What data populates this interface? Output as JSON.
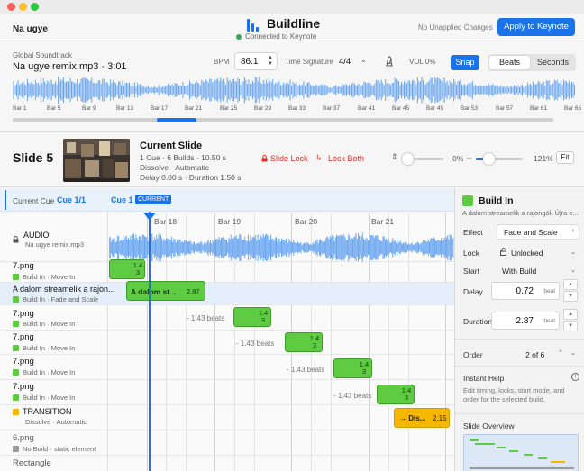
{
  "window": {
    "traffic": {
      "close": "#ff5f57",
      "minimize": "#febc2e",
      "zoom": "#28c840"
    }
  },
  "header": {
    "doc_title": "Na ugye",
    "app_name": "Buildline",
    "connection": "Connected to Keynote",
    "unapplied": "No Unapplied Changes",
    "apply_button": "Apply to Keynote"
  },
  "soundtrack": {
    "section_label": "Global Soundtrack",
    "track": "Na ugye remix.mp3 · 3:01",
    "bpm_label": "BPM",
    "bpm_value": "86.1",
    "ts_label": "Time Signature",
    "ts_value": "4/4",
    "volume": "VOL 0%",
    "snap": "Snap",
    "units": {
      "beats": "Beats",
      "seconds": "Seconds",
      "selected": "Beats"
    },
    "overview_bars": [
      "Bar 1",
      "Bar 5",
      "Bar 9",
      "Bar 13",
      "Bar 17",
      "Bar 21",
      "Bar 25",
      "Bar 29",
      "Bar 33",
      "Bar 37",
      "Bar 41",
      "Bar 45",
      "Bar 49",
      "Bar 53",
      "Bar 57",
      "Bar 61",
      "Bar 65"
    ]
  },
  "slide": {
    "number": "Slide 5",
    "title": "Current Slide",
    "summary": "1 Cue · 6 Builds · 10.50 s",
    "transition": "Dissolve · Automatic",
    "timing": "Delay 0.00 s · Duration 1.50 s",
    "slide_lock": "Slide Lock",
    "lock_both": "Lock Both",
    "zoom_v": "0%",
    "zoom_h": "121%",
    "fit": "Fit"
  },
  "timeline": {
    "current_cue_label": "Current Cue",
    "cue_count": "Cue 1/1",
    "cue_name": "Cue 1",
    "current_badge": "CURRENT",
    "bar_heads": [
      "Bar 18",
      "Bar 19",
      "Bar 20",
      "Bar 21"
    ],
    "audio": {
      "label": "AUDIO",
      "file": "Na ugye remix.mp3"
    },
    "rows": [
      {
        "name": "7.png",
        "action": "Build In · Move In",
        "clip_label": "",
        "clip_num": "1.4 3",
        "gap": ""
      },
      {
        "name": "A dalom streamelik a rajon...",
        "action": "Build In · Fade and Scale",
        "clip_label": "A dalom st...",
        "clip_num": "2.87",
        "gap": ""
      },
      {
        "name": "7.png",
        "action": "Build In · Move In",
        "clip_label": "",
        "clip_num": "1.4 3",
        "gap": "- 1.43 beats"
      },
      {
        "name": "7.png",
        "action": "Build In · Move In",
        "clip_label": "",
        "clip_num": "1.4 3",
        "gap": "- 1.43 beats"
      },
      {
        "name": "7.png",
        "action": "Build In · Move In",
        "clip_label": "",
        "clip_num": "1.4 3",
        "gap": "- 1.43 beats"
      },
      {
        "name": "7.png",
        "action": "Build In · Move In",
        "clip_label": "",
        "clip_num": "1.4 3",
        "gap": "- 1.43 beats"
      }
    ],
    "transition_row": {
      "name": "TRANSITION",
      "action": "Dissolve · Automatic",
      "clip_label": "→ Dis...",
      "clip_num": "2.15"
    },
    "static_row": {
      "name": "6.png",
      "action": "No Build · static element"
    },
    "last_row": {
      "name": "Rectangle"
    },
    "colors": {
      "build": "#5ecb43",
      "transition": "#f5b800",
      "static": "#9a9a9a",
      "accent": "#1a73e8"
    }
  },
  "inspector": {
    "title": "Build In",
    "desc": "A dalom streamelik a rajongók Újra e...",
    "effect_label": "Effect",
    "effect_value": "Fade and Scale",
    "lock_label": "Lock",
    "lock_value": "Unlocked",
    "start_label": "Start",
    "start_value": "With Build",
    "delay_label": "Delay",
    "delay_value": "0.72",
    "duration_label": "Duration",
    "duration_value": "2.87",
    "unit": "beat",
    "order_label": "Order",
    "order_value": "2 of 6",
    "help_title": "Instant Help",
    "help_text": "Edit timing, locks, start mode, and order for the selected build.",
    "overview_title": "Slide Overview"
  }
}
